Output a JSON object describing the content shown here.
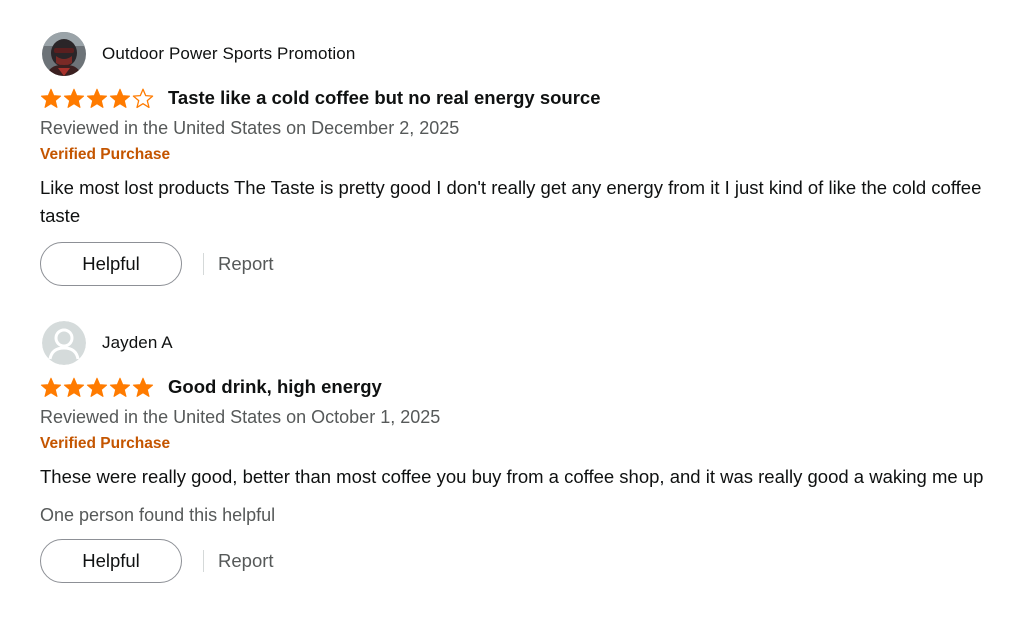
{
  "colors": {
    "star_fill": "#ff7b00",
    "verified": "#c45500",
    "secondary_text": "#565959",
    "primary_text": "#0f1111"
  },
  "reviews": [
    {
      "reviewer": "Outdoor Power Sports Promotion",
      "avatar_icon": "profile-photo-helmet-icon",
      "rating": 4,
      "rating_max": 5,
      "title": "Taste like a cold coffee but no real energy source",
      "date": "Reviewed in the United States on December 2, 2025",
      "verified": "Verified Purchase",
      "body": "Like most lost products The Taste is pretty good I don't really get any energy from it I just kind of like the cold coffee taste",
      "helpful_count": "",
      "helpful_label": "Helpful",
      "report_label": "Report"
    },
    {
      "reviewer": "Jayden A",
      "avatar_icon": "default-user-avatar-icon",
      "rating": 5,
      "rating_max": 5,
      "title": "Good drink, high energy",
      "date": "Reviewed in the United States on October 1, 2025",
      "verified": "Verified Purchase",
      "body": "These were really good, better than most coffee you buy from a coffee shop, and it was really good a waking me up",
      "helpful_count": "One person found this helpful",
      "helpful_label": "Helpful",
      "report_label": "Report"
    }
  ]
}
